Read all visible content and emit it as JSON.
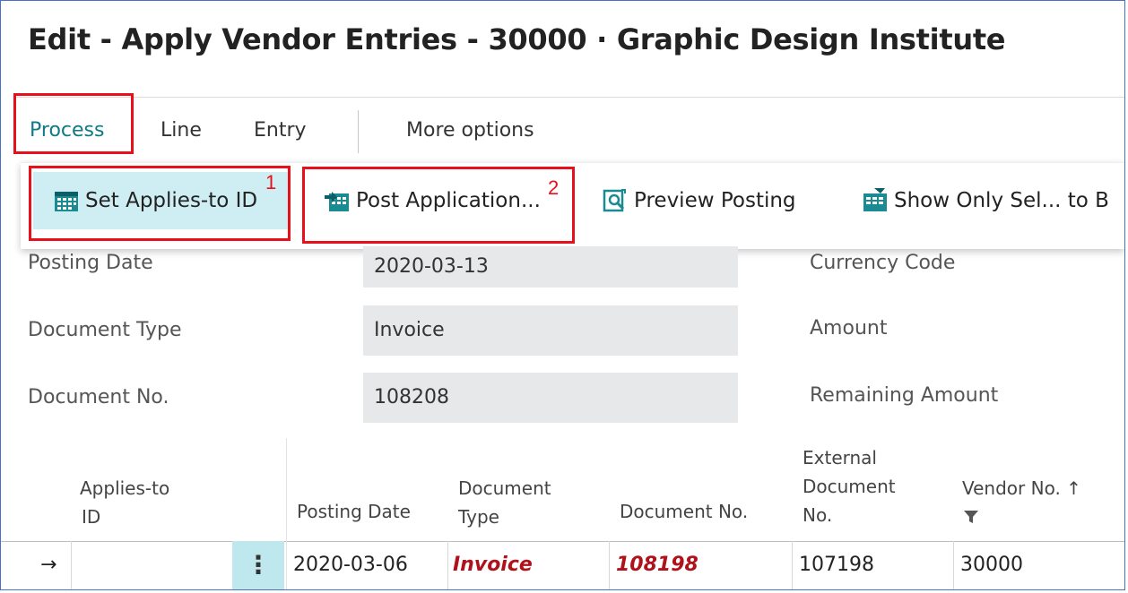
{
  "title": "Edit - Apply Vendor Entries - 30000 · Graphic Design Institute",
  "tabs": [
    {
      "label": "Process"
    },
    {
      "label": "Line"
    },
    {
      "label": "Entry"
    },
    {
      "label": "More options"
    }
  ],
  "actions": [
    {
      "label": "Set Applies-to ID",
      "icon": "calendar-icon"
    },
    {
      "label": "Post Application...",
      "icon": "post-application-icon"
    },
    {
      "label": "Preview Posting",
      "icon": "preview-posting-icon"
    },
    {
      "label": "Show Only Sel... to B",
      "icon": "show-only-selected-icon"
    }
  ],
  "callouts": [
    "1",
    "2"
  ],
  "fields": {
    "posting_date": {
      "label": "Posting Date",
      "value": "2020-03-13"
    },
    "document_type": {
      "label": "Document Type",
      "value": "Invoice"
    },
    "document_no": {
      "label": "Document No.",
      "value": "108208"
    },
    "currency_code": {
      "label": "Currency Code"
    },
    "amount": {
      "label": "Amount"
    },
    "remaining_amount": {
      "label": "Remaining Amount"
    }
  },
  "grid": {
    "headers": {
      "applies_to_id": [
        "Applies-to",
        "ID"
      ],
      "posting_date": [
        "Posting Date"
      ],
      "document_type": [
        "Document",
        "Type"
      ],
      "document_no": [
        "Document No."
      ],
      "external_document_no": [
        "External",
        "Document",
        "No."
      ],
      "vendor_no": [
        "Vendor No. ↑"
      ]
    },
    "rows": [
      {
        "arrow": "→",
        "applies_to_id": "",
        "menu": "⋮",
        "posting_date": "2020-03-06",
        "document_type": "Invoice",
        "document_no": "108198",
        "external_document_no": "107198",
        "vendor_no": "30000"
      }
    ]
  },
  "colors": {
    "accent": "#0e7a85",
    "highlight": "#e8111b",
    "selected_action": "#cfeef3",
    "overdue_text": "#b0121b"
  }
}
